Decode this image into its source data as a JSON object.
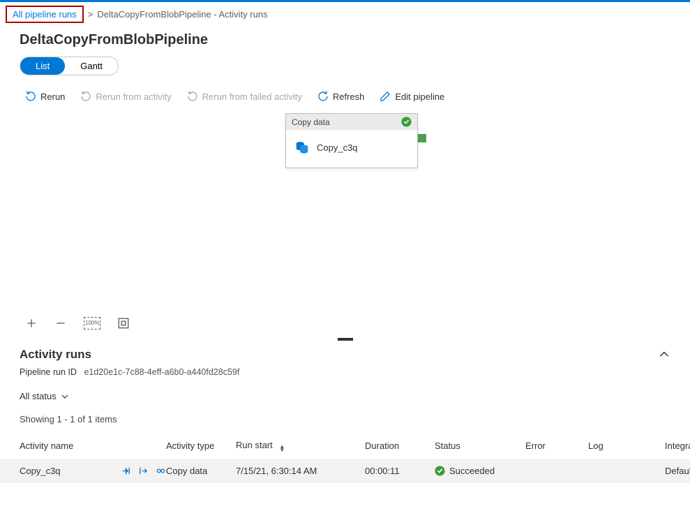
{
  "breadcrumb": {
    "root": "All pipeline runs",
    "current": "DeltaCopyFromBlobPipeline - Activity runs"
  },
  "page": {
    "title": "DeltaCopyFromBlobPipeline"
  },
  "viewToggle": {
    "list": "List",
    "gantt": "Gantt"
  },
  "toolbar": {
    "rerun": "Rerun",
    "rerun_activity": "Rerun from activity",
    "rerun_failed": "Rerun from failed activity",
    "refresh": "Refresh",
    "edit": "Edit pipeline"
  },
  "canvas": {
    "node": {
      "header": "Copy data",
      "name": "Copy_c3q"
    }
  },
  "zoom": {
    "percent": "100%"
  },
  "activityRuns": {
    "title": "Activity runs",
    "runid_label": "Pipeline run ID",
    "runid_value": "e1d20e1c-7c88-4eff-a6b0-a440fd28c59f",
    "filter": "All status",
    "showing": "Showing 1 - 1 of 1 items",
    "headers": {
      "name": "Activity name",
      "type": "Activity type",
      "start": "Run start",
      "duration": "Duration",
      "status": "Status",
      "error": "Error",
      "log": "Log",
      "integration": "Integration r"
    },
    "rows": [
      {
        "name": "Copy_c3q",
        "type": "Copy data",
        "start": "7/15/21, 6:30:14 AM",
        "duration": "00:00:11",
        "status": "Succeeded",
        "error": "",
        "log": "",
        "integration": "DefaultIntegr"
      }
    ]
  }
}
